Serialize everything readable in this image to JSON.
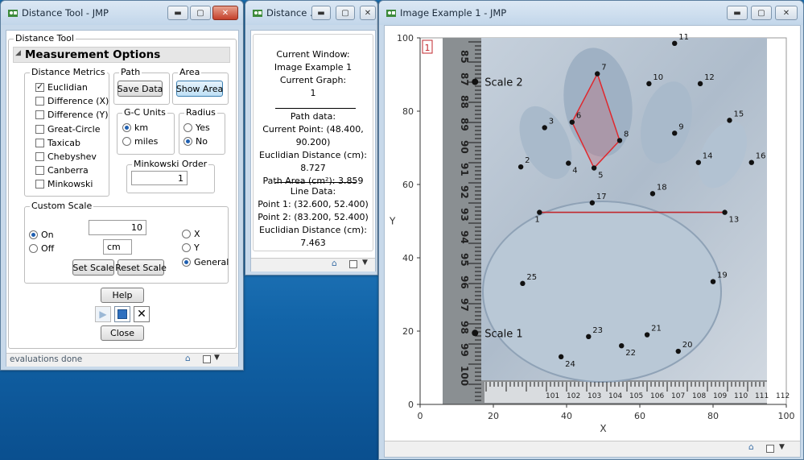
{
  "colors": {
    "accent": "#1f5fb0",
    "path": "#e0282e",
    "line": "#c1272d"
  },
  "win1": {
    "title": "Distance Tool - JMP",
    "outline": "Distance Tool",
    "header": "Measurement Options",
    "metrics": {
      "label": "Distance Metrics",
      "items": [
        "Euclidian",
        "Difference (X)",
        "Difference (Y)",
        "Great-Circle",
        "Taxicab",
        "Chebyshev",
        "Canberra",
        "Minkowski"
      ],
      "checked": 0
    },
    "path": {
      "label": "Path",
      "save": "Save Data"
    },
    "area": {
      "label": "Area",
      "show": "Show Area"
    },
    "gc": {
      "label": "G-C Units",
      "km": "km",
      "miles": "miles"
    },
    "radius": {
      "label": "Radius",
      "yes": "Yes",
      "no": "No"
    },
    "minkowski": {
      "label": "Minkowski Order",
      "value": "1"
    },
    "custom": {
      "label": "Custom Scale",
      "on": "On",
      "off": "Off",
      "value": "10",
      "unit": "cm",
      "set": "Set Scale",
      "reset": "Reset Scale",
      "x": "X",
      "y": "Y",
      "general": "General"
    },
    "help": "Help",
    "close": "Close",
    "status": "evaluations done"
  },
  "win2": {
    "title": "Distance ...",
    "lines": [
      "Current Window:",
      "Image Example 1",
      "Current Graph:",
      "1"
    ],
    "path_lines": [
      "Path data:",
      "Current Point: (48.400, 90.200)",
      "Euclidian Distance (cm):",
      "8.727",
      "Path Area (cm²): 3.859"
    ],
    "line_lines": [
      "Line Data:",
      "Point 1: (32.600, 52.400)",
      "Point 2: (83.200, 52.400)",
      "Euclidian Distance (cm):",
      "7.463"
    ]
  },
  "win3": {
    "title": "Image Example 1 - JMP",
    "graph_label": "1",
    "xlabel": "X",
    "ylabel": "Y",
    "ticks": [
      "0",
      "20",
      "40",
      "60",
      "80",
      "100"
    ],
    "scale_labels": [
      "Scale 2",
      "Scale 1"
    ]
  },
  "chart_data": {
    "type": "scatter",
    "xlabel": "X",
    "ylabel": "Y",
    "xlim": [
      0,
      100
    ],
    "ylim": [
      0,
      100
    ],
    "points": [
      {
        "id": "1",
        "x": 32.6,
        "y": 52.4
      },
      {
        "id": "2",
        "x": 27.5,
        "y": 64.8
      },
      {
        "id": "3",
        "x": 34,
        "y": 75.5
      },
      {
        "id": "4",
        "x": 40.5,
        "y": 65.8
      },
      {
        "id": "5",
        "x": 47.5,
        "y": 64.5
      },
      {
        "id": "6",
        "x": 41.5,
        "y": 77
      },
      {
        "id": "7",
        "x": 48.4,
        "y": 90.2
      },
      {
        "id": "8",
        "x": 54.5,
        "y": 72
      },
      {
        "id": "9",
        "x": 69.5,
        "y": 74
      },
      {
        "id": "10",
        "x": 62.5,
        "y": 87.5
      },
      {
        "id": "11",
        "x": 69.5,
        "y": 98.5
      },
      {
        "id": "12",
        "x": 76.5,
        "y": 87.5
      },
      {
        "id": "13",
        "x": 83.2,
        "y": 52.4
      },
      {
        "id": "14",
        "x": 76,
        "y": 66
      },
      {
        "id": "15",
        "x": 84.5,
        "y": 77.5
      },
      {
        "id": "16",
        "x": 90.5,
        "y": 66
      },
      {
        "id": "17",
        "x": 47,
        "y": 55
      },
      {
        "id": "18",
        "x": 63.5,
        "y": 57.5
      },
      {
        "id": "19",
        "x": 80,
        "y": 33.5
      },
      {
        "id": "20",
        "x": 70.5,
        "y": 14.5
      },
      {
        "id": "21",
        "x": 62,
        "y": 19
      },
      {
        "id": "22",
        "x": 55,
        "y": 16
      },
      {
        "id": "23",
        "x": 46,
        "y": 18.5
      },
      {
        "id": "24",
        "x": 38.5,
        "y": 13
      },
      {
        "id": "25",
        "x": 28,
        "y": 33
      }
    ],
    "path": [
      "6",
      "7",
      "8",
      "5",
      "6"
    ],
    "line": [
      "1",
      "13"
    ],
    "ruler_labels": [
      "85",
      "87",
      "88",
      "89",
      "90",
      "91",
      "92",
      "93",
      "94",
      "95",
      "96",
      "97",
      "98",
      "99",
      "100",
      "101",
      "102",
      "103",
      "104",
      "105",
      "106",
      "107",
      "108",
      "109",
      "110",
      "111",
      "112"
    ]
  }
}
